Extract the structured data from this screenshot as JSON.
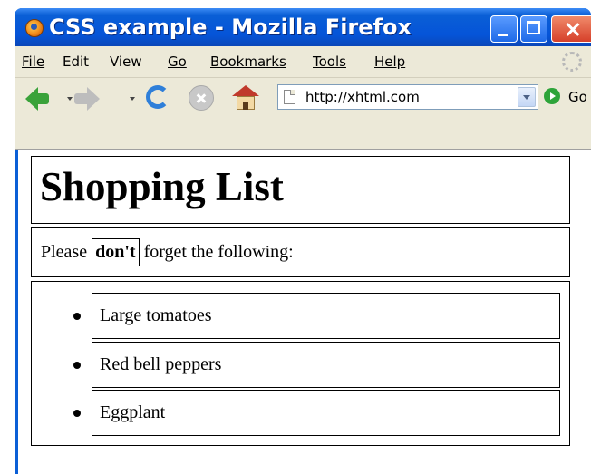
{
  "window": {
    "title": "CSS example - Mozilla Firefox"
  },
  "menu": {
    "items": [
      {
        "label": "File"
      },
      {
        "label": "Edit"
      },
      {
        "label": "View"
      },
      {
        "label": "Go"
      },
      {
        "label": "Bookmarks"
      },
      {
        "label": "Tools"
      },
      {
        "label": "Help"
      }
    ]
  },
  "navigation": {
    "url": "http://xhtml.com",
    "go_label": "Go"
  },
  "page": {
    "heading": "Shopping List",
    "intro_before": "Please",
    "intro_emphasis": "don't",
    "intro_after": "forget the following:",
    "items": [
      {
        "text": "Large tomatoes"
      },
      {
        "text": "Red bell peppers"
      },
      {
        "text": "Eggplant"
      }
    ]
  },
  "colors": {
    "titlebar": "#0a5fd6",
    "chrome": "#ece9d8",
    "go_button": "#2ea43a"
  }
}
